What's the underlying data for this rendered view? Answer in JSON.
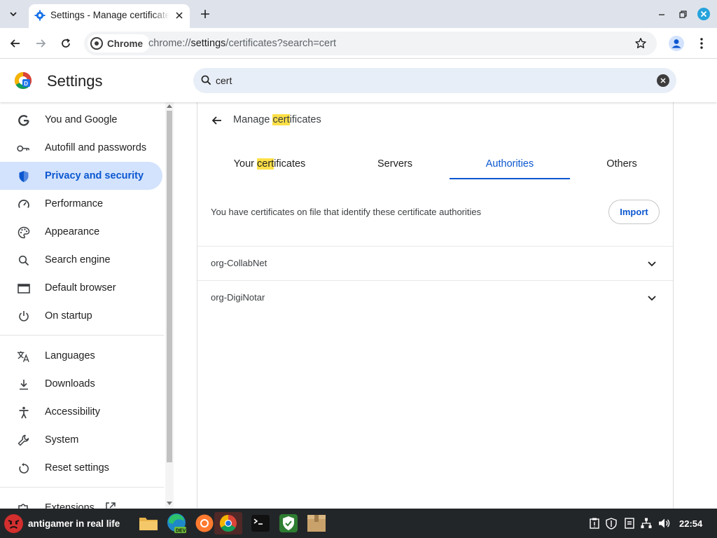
{
  "browser": {
    "tab_title": "Settings - Manage certificates",
    "site_chip": "Chrome",
    "url_scheme": "chrome://",
    "url_host": "settings",
    "url_path": "/certificates?search=cert"
  },
  "settings": {
    "title": "Settings",
    "search_value": "cert"
  },
  "sidebar": {
    "items": [
      {
        "label": "You and Google",
        "icon": "google-icon"
      },
      {
        "label": "Autofill and passwords",
        "icon": "key-icon"
      },
      {
        "label": "Privacy and security",
        "icon": "shield-icon",
        "active": true
      },
      {
        "label": "Performance",
        "icon": "speedometer-icon"
      },
      {
        "label": "Appearance",
        "icon": "palette-icon"
      },
      {
        "label": "Search engine",
        "icon": "search-icon"
      },
      {
        "label": "Default browser",
        "icon": "browser-window-icon"
      },
      {
        "label": "On startup",
        "icon": "power-icon"
      },
      {
        "label": "Languages",
        "icon": "translate-icon"
      },
      {
        "label": "Downloads",
        "icon": "download-icon"
      },
      {
        "label": "Accessibility",
        "icon": "accessibility-icon"
      },
      {
        "label": "System",
        "icon": "wrench-icon"
      },
      {
        "label": "Reset settings",
        "icon": "reset-icon"
      },
      {
        "label": "Extensions",
        "icon": "puzzle-icon"
      }
    ]
  },
  "certificates": {
    "title_prefix": "Manage ",
    "title_highlight": "cert",
    "title_suffix": "ificates",
    "tabs": [
      {
        "prefix": "Your ",
        "highlight": "cert",
        "suffix": "ificates"
      },
      {
        "prefix": "Servers",
        "highlight": "",
        "suffix": ""
      },
      {
        "prefix": "Authorities",
        "highlight": "",
        "suffix": "",
        "active": true
      },
      {
        "prefix": "Others",
        "highlight": "",
        "suffix": ""
      }
    ],
    "description": "You have certificates on file that identify these certificate authorities",
    "import_label": "Import",
    "authorities": [
      "org-CollabNet",
      "org-DigiNotar"
    ]
  },
  "taskbar": {
    "user": "antigamer in real life",
    "clock": "22:54"
  },
  "colors": {
    "accent": "#0b57d0",
    "active_nav_bg": "#d3e3fd",
    "search_highlight": "#fde047",
    "taskbar_bg": "#232629"
  }
}
